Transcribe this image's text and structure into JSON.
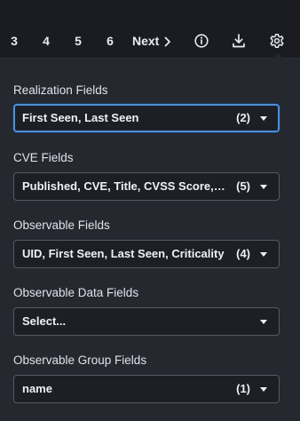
{
  "pagination": {
    "pages": [
      "3",
      "4",
      "5",
      "6"
    ],
    "next_label": "Next"
  },
  "toolbar": {
    "icons": [
      "info-icon",
      "download-icon",
      "gear-icon"
    ]
  },
  "panel": {
    "fields": [
      {
        "label": "Realization Fields",
        "value": "First Seen, Last Seen",
        "count": "(2)",
        "focused": true
      },
      {
        "label": "CVE Fields",
        "value": "Published, CVE, Title, CVSS Score, ...",
        "count": "(5)",
        "focused": false
      },
      {
        "label": "Observable Fields",
        "value": "UID, First Seen, Last Seen, Criticality",
        "count": "(4)",
        "focused": false
      },
      {
        "label": "Observable Data Fields",
        "value": "Select...",
        "count": "",
        "focused": false
      },
      {
        "label": "Observable Group Fields",
        "value": "name",
        "count": "(1)",
        "focused": false
      }
    ]
  },
  "colors": {
    "background": "#1a1c21",
    "panel": "#25282f",
    "focus_ring": "#4e8fd8",
    "text": "#eef0f4"
  }
}
